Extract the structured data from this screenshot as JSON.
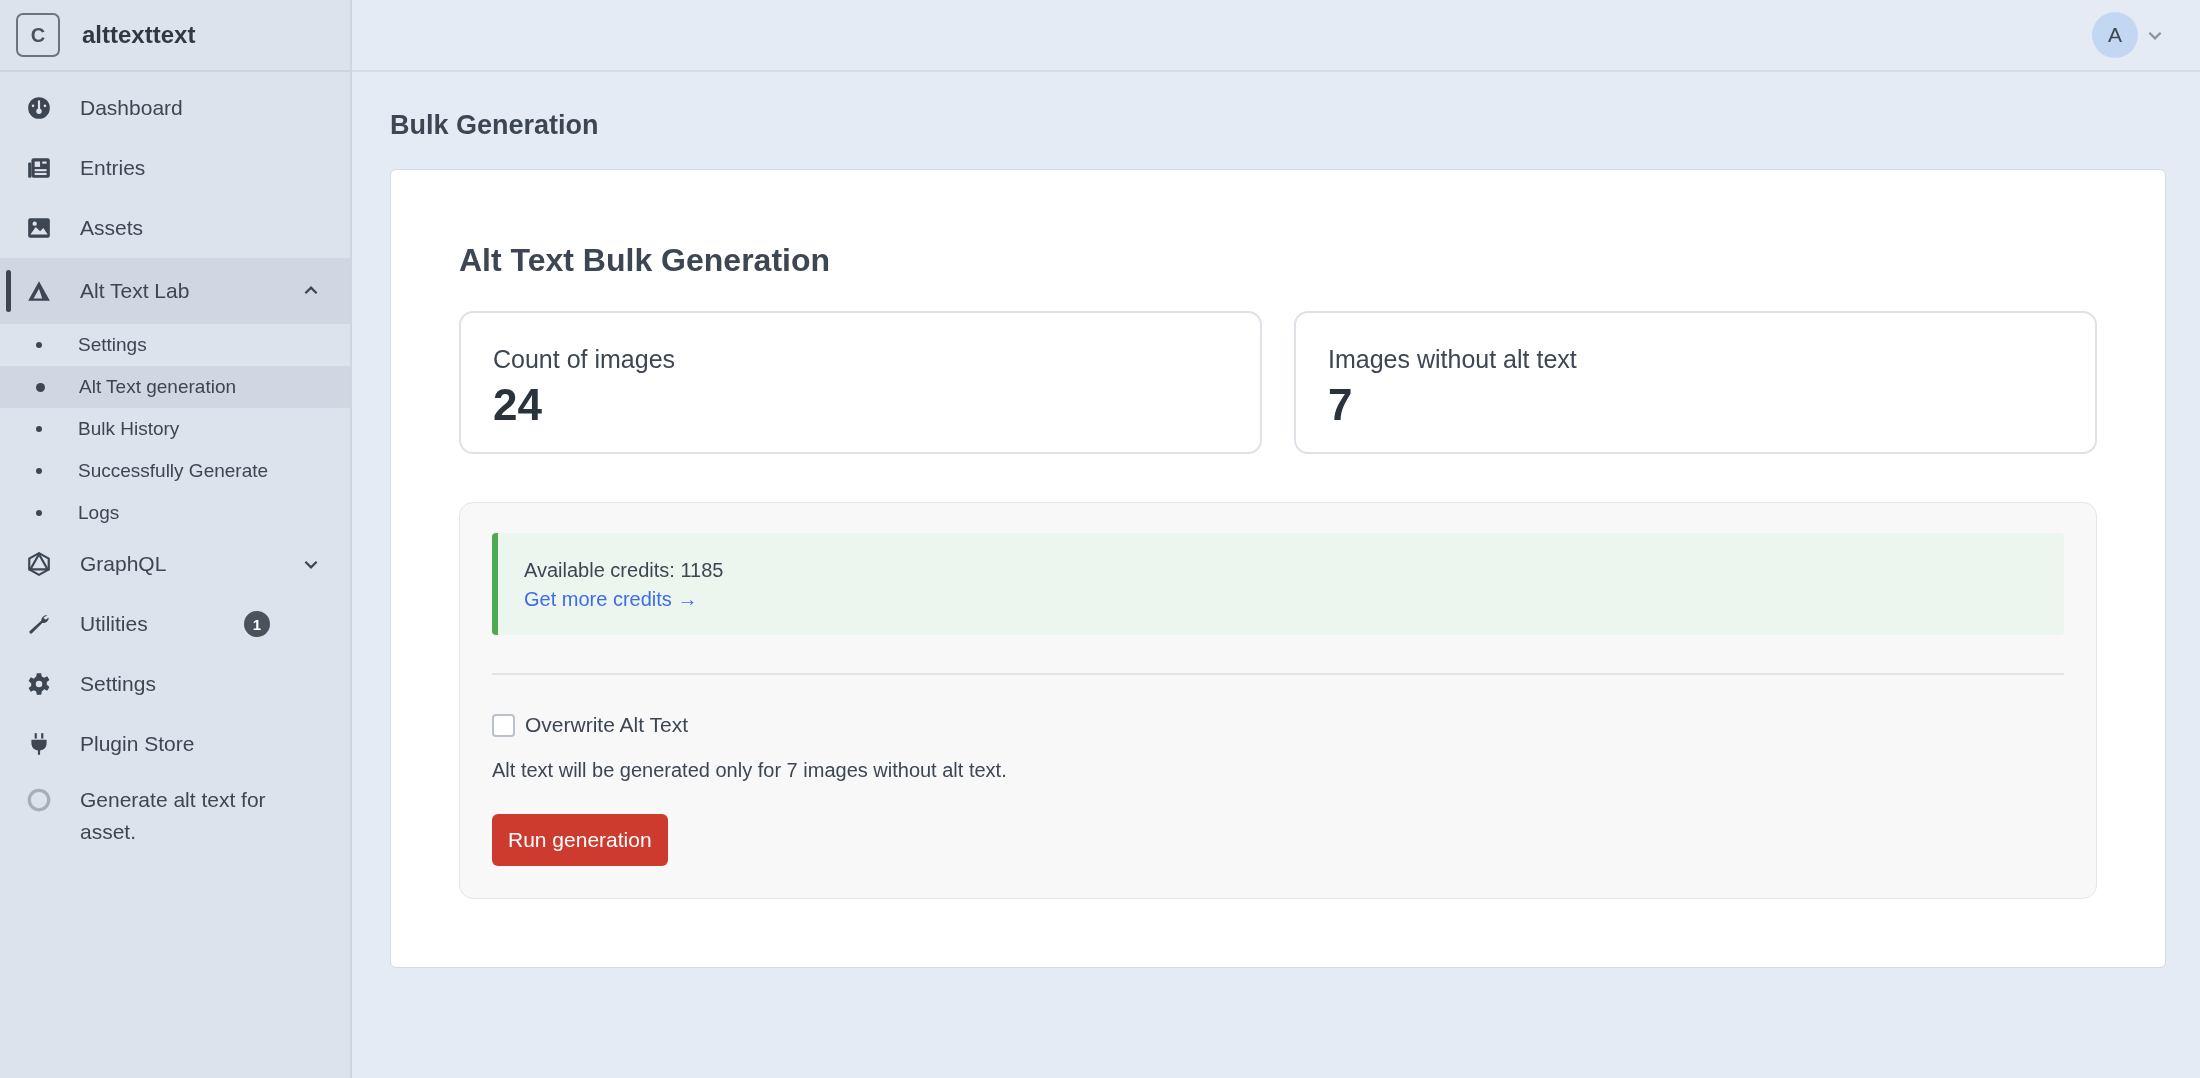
{
  "site": {
    "logo_letter": "C",
    "name": "alttexttext"
  },
  "sidebar": {
    "items": [
      {
        "label": "Dashboard",
        "selected": false
      },
      {
        "label": "Entries",
        "selected": false
      },
      {
        "label": "Assets",
        "selected": false
      },
      {
        "label": "Alt Text Lab",
        "selected": true,
        "expanded": true,
        "children": [
          {
            "label": "Settings",
            "selected": false
          },
          {
            "label": "Alt Text generation",
            "selected": true
          },
          {
            "label": "Bulk History",
            "selected": false
          },
          {
            "label": "Successfully Generate",
            "selected": false
          },
          {
            "label": "Logs",
            "selected": false
          }
        ]
      },
      {
        "label": "GraphQL",
        "selected": false,
        "expanded": false
      },
      {
        "label": "Utilities",
        "selected": false,
        "badge": "1"
      },
      {
        "label": "Settings",
        "selected": false
      },
      {
        "label": "Plugin Store",
        "selected": false
      },
      {
        "label": "Generate alt text for asset.",
        "selected": false
      }
    ]
  },
  "header": {
    "avatar_letter": "A"
  },
  "page_title": "Bulk Generation",
  "card": {
    "title": "Alt Text Bulk Generation",
    "stats": [
      {
        "label": "Count of images",
        "value": "24"
      },
      {
        "label": "Images without alt text",
        "value": "7"
      }
    ],
    "credits": {
      "text": "Available credits: 1185",
      "link": "Get more credits →"
    },
    "overwrite": {
      "label": "Overwrite Alt Text",
      "checked": false
    },
    "note": "Alt text will be generated only for 7 images without alt text.",
    "button": "Run generation"
  }
}
